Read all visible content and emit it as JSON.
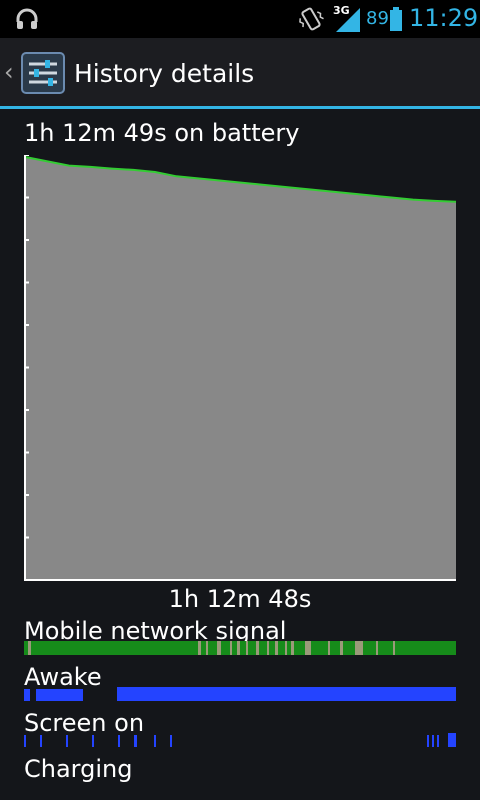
{
  "status_bar": {
    "network_type": "3G",
    "battery_percent": "89",
    "time": "11:29",
    "icons": [
      "headphones-icon",
      "vibrate-icon",
      "signal-icon",
      "battery-icon"
    ],
    "accent_color": "#33b5e5"
  },
  "action_bar": {
    "title": "History details",
    "icon": "settings-sliders-icon",
    "up_icon": "back-caret-icon"
  },
  "history": {
    "summary": "1h 12m 49s on battery",
    "duration_label": "1h 12m 48s",
    "battery_start_level": 0.995,
    "battery_end_level": 0.89,
    "battery_curve": [
      0.995,
      0.985,
      0.975,
      0.972,
      0.968,
      0.965,
      0.96,
      0.95,
      0.945,
      0.94,
      0.935,
      0.93,
      0.925,
      0.92,
      0.915,
      0.91,
      0.905,
      0.9,
      0.895,
      0.892,
      0.89
    ],
    "line_color": "#33cc33",
    "fill_color": "#888888",
    "rows": [
      {
        "label": "Mobile network signal",
        "color": "#168b1a"
      },
      {
        "label": "Awake",
        "color": "#2444ff"
      },
      {
        "label": "Screen on",
        "color": "#2444ff"
      },
      {
        "label": "Charging",
        "color": "#2444ff"
      }
    ]
  }
}
